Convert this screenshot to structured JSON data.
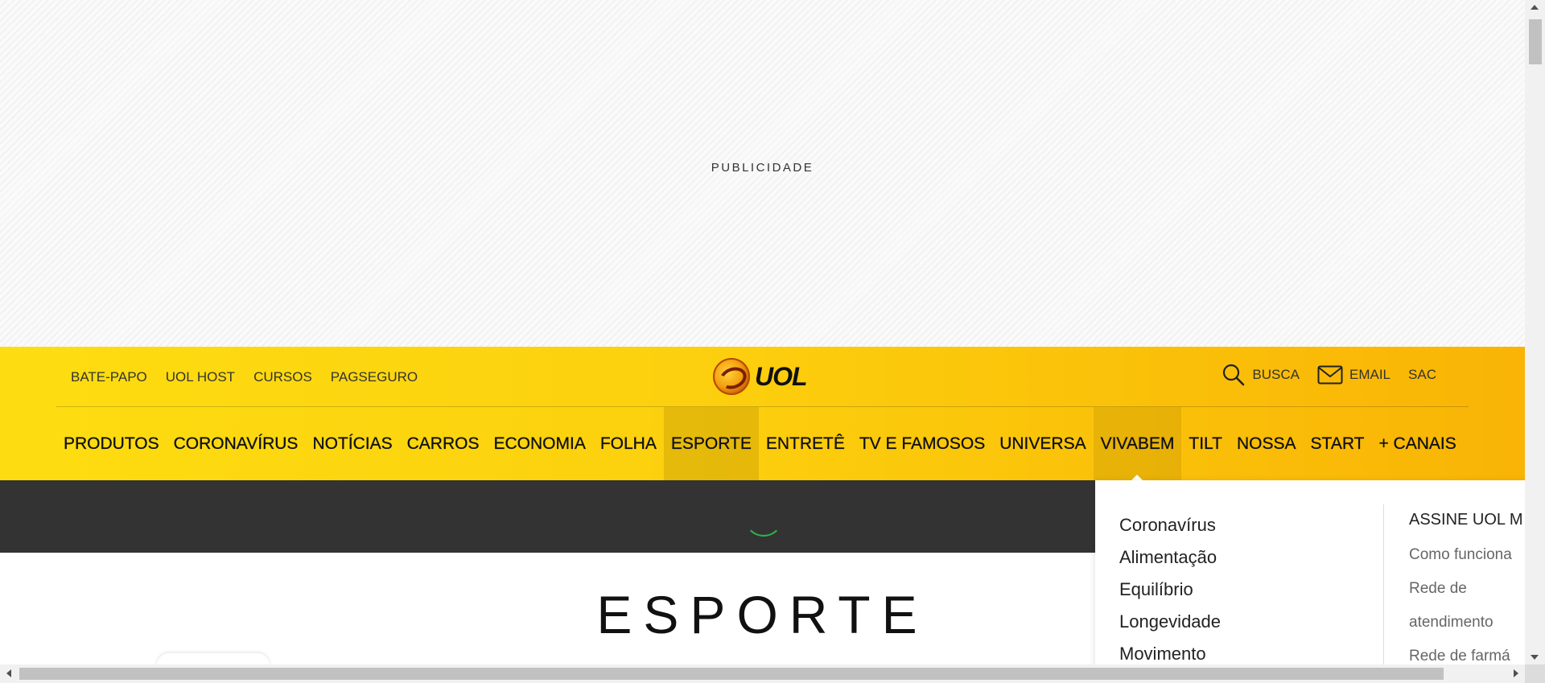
{
  "ad": {
    "label": "PUBLICIDADE"
  },
  "header": {
    "top_links": [
      "BATE-PAPO",
      "UOL HOST",
      "CURSOS",
      "PAGSEGURO"
    ],
    "logo_text": "UOL",
    "right_links": {
      "search": "BUSCA",
      "email": "EMAIL",
      "sac": "SAC"
    },
    "nav": [
      "PRODUTOS",
      "CORONAVÍRUS",
      "NOTÍCIAS",
      "CARROS",
      "ECONOMIA",
      "FOLHA",
      "ESPORTE",
      "ENTRETÊ",
      "TV E FAMOSOS",
      "UNIVERSA",
      "VIVABEM",
      "TILT",
      "NOSSA",
      "START",
      "+ CANAIS"
    ],
    "active_nav": "ESPORTE",
    "open_nav": "VIVABEM"
  },
  "dropdown": {
    "items": [
      "Coronavírus",
      "Alimentação",
      "Equilíbrio",
      "Longevidade",
      "Movimento"
    ],
    "side_title": "ASSINE UOL M",
    "side_links": [
      "Como funciona",
      "Rede de atendimento",
      "Rede de farmá"
    ]
  },
  "section": {
    "title": "ESPORTE"
  },
  "colors": {
    "header_start": "#fddd11",
    "header_end": "#f9b405",
    "dark_band": "#333333",
    "spinner": "#2fb14a"
  },
  "icons": [
    "search-icon",
    "mail-icon",
    "uol-logo-icon"
  ]
}
